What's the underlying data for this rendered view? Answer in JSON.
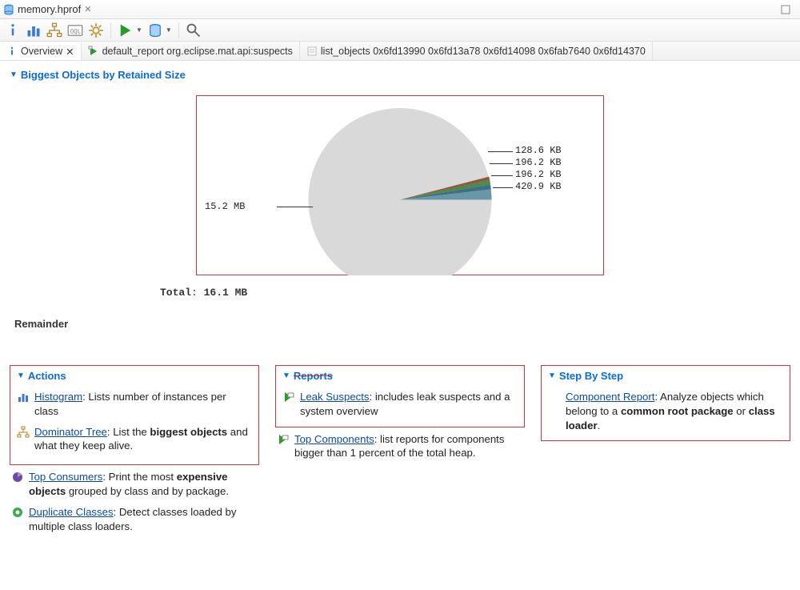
{
  "window": {
    "title": "memory.hprof",
    "close_glyph": "✕"
  },
  "tabs": [
    {
      "label": "Overview",
      "icon": "info-icon",
      "active": true,
      "closeable": true
    },
    {
      "label": "default_report  org.eclipse.mat.api:suspects",
      "icon": "report-tree-icon",
      "active": false
    },
    {
      "label": "list_objects  0x6fd13990 0x6fd13a78 0x6fd14098 0x6fab7640 0x6fd14370",
      "icon": "list-icon",
      "active": false
    }
  ],
  "section_title": "Biggest Objects by Retained Size",
  "chart_data": {
    "type": "pie",
    "title": "",
    "total_label": "Total",
    "total_value": "16.1 MB",
    "remainder_label": "Remainder",
    "slices": [
      {
        "label": "15.2 MB",
        "value_mb": 15.2,
        "color": "#d9d9d9"
      },
      {
        "label": "420.9 KB",
        "value_mb": 0.4111,
        "color": "#6b96a8"
      },
      {
        "label": "196.2 KB",
        "value_mb": 0.1916,
        "color": "#3f6e87"
      },
      {
        "label": "196.2 KB",
        "value_mb": 0.1916,
        "color": "#4b8a4b"
      },
      {
        "label": "128.6 KB",
        "value_mb": 0.1256,
        "color": "#8a5a3a"
      }
    ]
  },
  "cols": {
    "actions": {
      "title": "Actions",
      "items": [
        {
          "icon": "histogram-icon",
          "link": "Histogram",
          "desc": ": Lists number of instances per class"
        },
        {
          "icon": "tree-icon",
          "link": "Dominator Tree",
          "desc_pre": ": List the ",
          "bold": "biggest objects",
          "desc_post": " and what they keep alive."
        },
        {
          "icon": "consumers-icon",
          "link": "Top Consumers",
          "desc_pre": ": Print the most ",
          "bold": "expensive objects",
          "desc_post": " grouped by class and by package."
        },
        {
          "icon": "duplicate-icon",
          "link": "Duplicate Classes",
          "desc": ": Detect classes loaded by multiple class loaders."
        }
      ]
    },
    "reports": {
      "title": "Reports",
      "items": [
        {
          "icon": "report-tree-icon",
          "link": "Leak Suspects",
          "desc": ": includes leak suspects and a system overview"
        },
        {
          "icon": "report-tree-icon",
          "link": "Top Components",
          "desc": ": list reports for components bigger than 1 percent of the total heap."
        }
      ]
    },
    "step": {
      "title": "Step By Step",
      "items": [
        {
          "icon": "",
          "link": "Component Report",
          "desc_pre": ": Analyze objects which belong to a ",
          "bold": "common root package",
          "desc_post": " or ",
          "bold2": "class loader",
          "desc_end": "."
        }
      ]
    }
  }
}
